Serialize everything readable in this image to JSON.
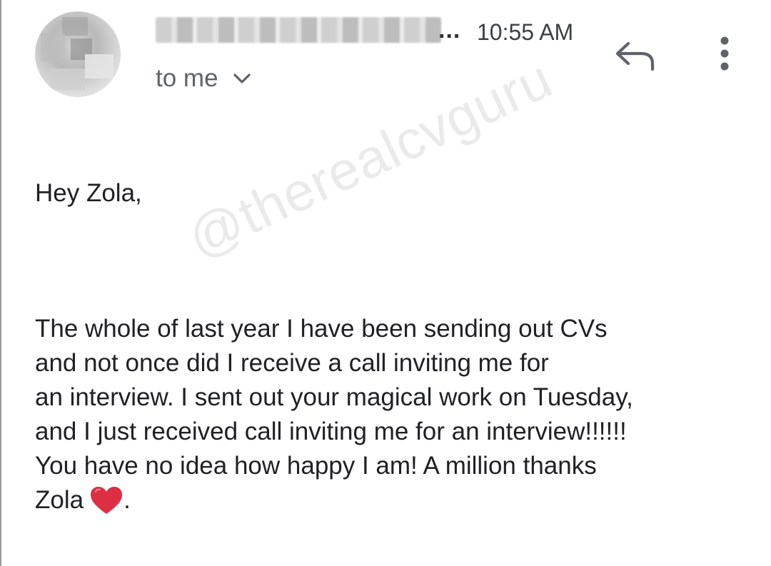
{
  "header": {
    "sender_ellipsis": "...",
    "time": "10:55 AM",
    "recipient": "to me"
  },
  "icons": {
    "avatar": "avatar-blurred",
    "recipient_toggle": "chevron-down-icon",
    "reply": "reply-icon",
    "more": "more-vert-icon",
    "heart": "red-heart-emoji"
  },
  "watermark": "@therealcvguru",
  "message": {
    "greeting": "Hey Zola,",
    "lines": [
      "The whole of last year I have been sending out CVs",
      "and not once did I receive a call inviting me for",
      "an interview. I sent out your magical work on Tuesday,",
      "and I just received call inviting me for an interview!!!!!!",
      "You have no idea how happy I am! A million thanks"
    ],
    "closing_name": "Zola",
    "closing_punctuation": "."
  },
  "colors": {
    "text": "#202124",
    "secondary": "#5f6368",
    "icon": "#5f6368",
    "heart": "#dd2e44"
  }
}
